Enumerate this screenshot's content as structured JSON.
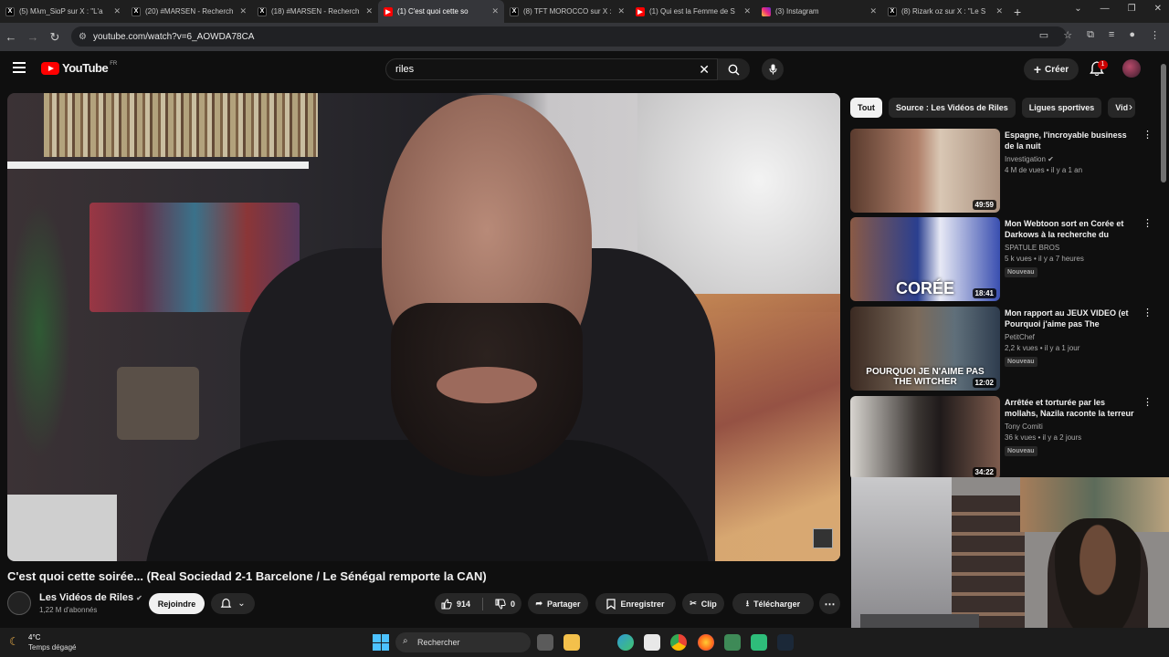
{
  "browser": {
    "tabs": [
      {
        "label": "(5) Mλm_SiαP sur X : \"L'a",
        "fav": "x",
        "active": false
      },
      {
        "label": "(20) #MARSEN - Recherch",
        "fav": "x",
        "active": false
      },
      {
        "label": "(18) #MARSEN - Recherch",
        "fav": "x",
        "active": false
      },
      {
        "label": "(1) C'est quoi cette so",
        "fav": "yt",
        "active": true
      },
      {
        "label": "(8) TFT MOROCCO sur X :",
        "fav": "x",
        "active": false
      },
      {
        "label": "(1) Qui est la Femme de S",
        "fav": "yt",
        "active": false
      },
      {
        "label": "(3) Instagram",
        "fav": "ig",
        "active": false
      },
      {
        "label": "(8) Rizark oz sur X : \"Le S",
        "fav": "x",
        "active": false
      }
    ],
    "new_tab": "+",
    "url": "youtube.com/watch?v=6_AOWDA78CA"
  },
  "youtube": {
    "logo_text": "YouTube",
    "country": "FR",
    "search_value": "riles",
    "create_label": "Créer",
    "notif_count": "1"
  },
  "video": {
    "title": "C'est quoi cette soirée... (Real Sociedad 2-1 Barcelone / Le Sénégal remporte la CAN)",
    "channel": "Les Vidéos de Riles",
    "subscribers": "1,22 M d'abonnés",
    "join_label": "Rejoindre",
    "likes": "914",
    "dislikes": "0",
    "share_label": "Partager",
    "save_label": "Enregistrer",
    "clip_label": "Clip",
    "download_label": "Télécharger"
  },
  "chips": [
    "Tout",
    "Source : Les Vidéos de Riles",
    "Ligues sportives",
    "Vid"
  ],
  "recommendations": [
    {
      "title": "Espagne, l'incroyable business de la nuit",
      "channel": "Investigation",
      "verified": true,
      "meta": "4 M de vues • il y a 1 an",
      "duration": "49:59",
      "badge": ""
    },
    {
      "title": "Mon Webtoon sort en Corée et Darkows à la recherche du JUM…",
      "channel": "SPATULE BROS",
      "verified": false,
      "meta": "5 k vues • il y a 7 heures",
      "duration": "18:41",
      "badge": "Nouveau",
      "thumb_text": "CORÉE"
    },
    {
      "title": "Mon rapport au JEUX VIDEO (et Pourquoi j'aime pas The Witcher…",
      "channel": "PetitChef",
      "verified": false,
      "meta": "2,2 k vues • il y a 1 jour",
      "duration": "12:02",
      "badge": "Nouveau",
      "thumb_text": "POURQUOI JE N'AIME PAS THE WITCHER"
    },
    {
      "title": "Arrêtée et torturée par les mollahs, Nazila raconte la terreur",
      "channel": "Tony Comiti",
      "verified": false,
      "meta": "36 k vues • il y a 2 jours",
      "duration": "34:22",
      "badge": "Nouveau"
    }
  ],
  "taskbar": {
    "temp": "4°C",
    "weather": "Temps dégagé",
    "search_placeholder": "Rechercher"
  }
}
